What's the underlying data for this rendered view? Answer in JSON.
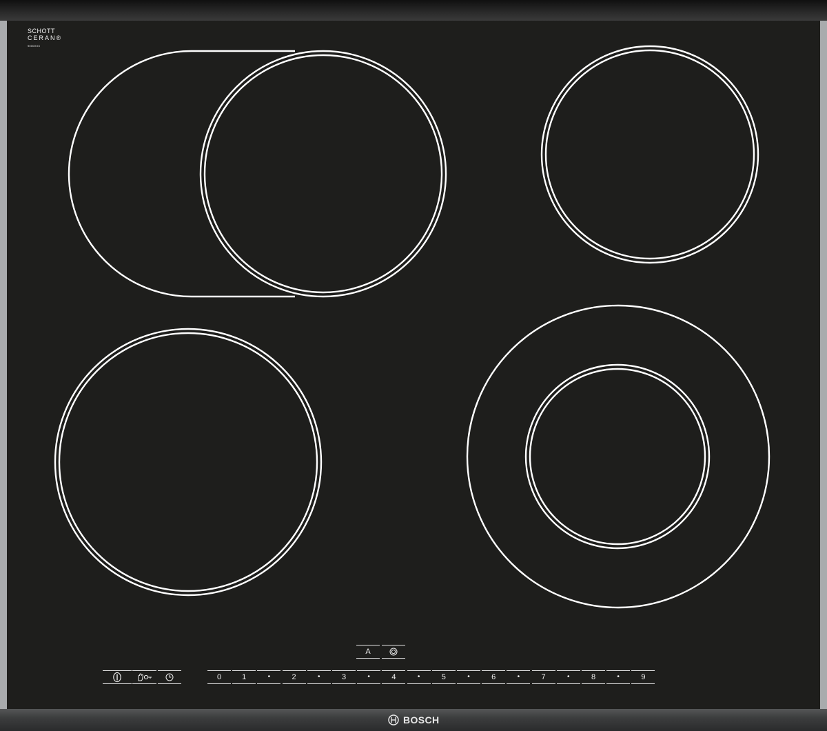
{
  "brand": {
    "glass_logo_line1": "SCHOTT",
    "glass_logo_line2": "CERAN®",
    "glass_code": "9000XXX",
    "manufacturer": "BOSCH",
    "bosch_icon": "bosch-armature-logo-icon"
  },
  "colors": {
    "glass": "#1e1e1c",
    "frame": "#a9abad",
    "marking": "#ffffff"
  },
  "zones": [
    {
      "name": "extended-roaster-zone"
    },
    {
      "name": "single-zone-top-right"
    },
    {
      "name": "single-zone-bottom-left"
    },
    {
      "name": "dual-zone-bottom-right"
    }
  ],
  "function_keys": {
    "auto_label": "A",
    "fry_icon": "frying-sensor-icon"
  },
  "control_keys": [
    {
      "icon": "power-icon"
    },
    {
      "icon": "child-lock-icon"
    },
    {
      "icon": "timer-icon"
    }
  ],
  "power_scale": [
    "0",
    "1",
    "•",
    "2",
    "•",
    "3",
    "•",
    "4",
    "•",
    "5",
    "•",
    "6",
    "•",
    "7",
    "•",
    "8",
    "•",
    "9"
  ]
}
